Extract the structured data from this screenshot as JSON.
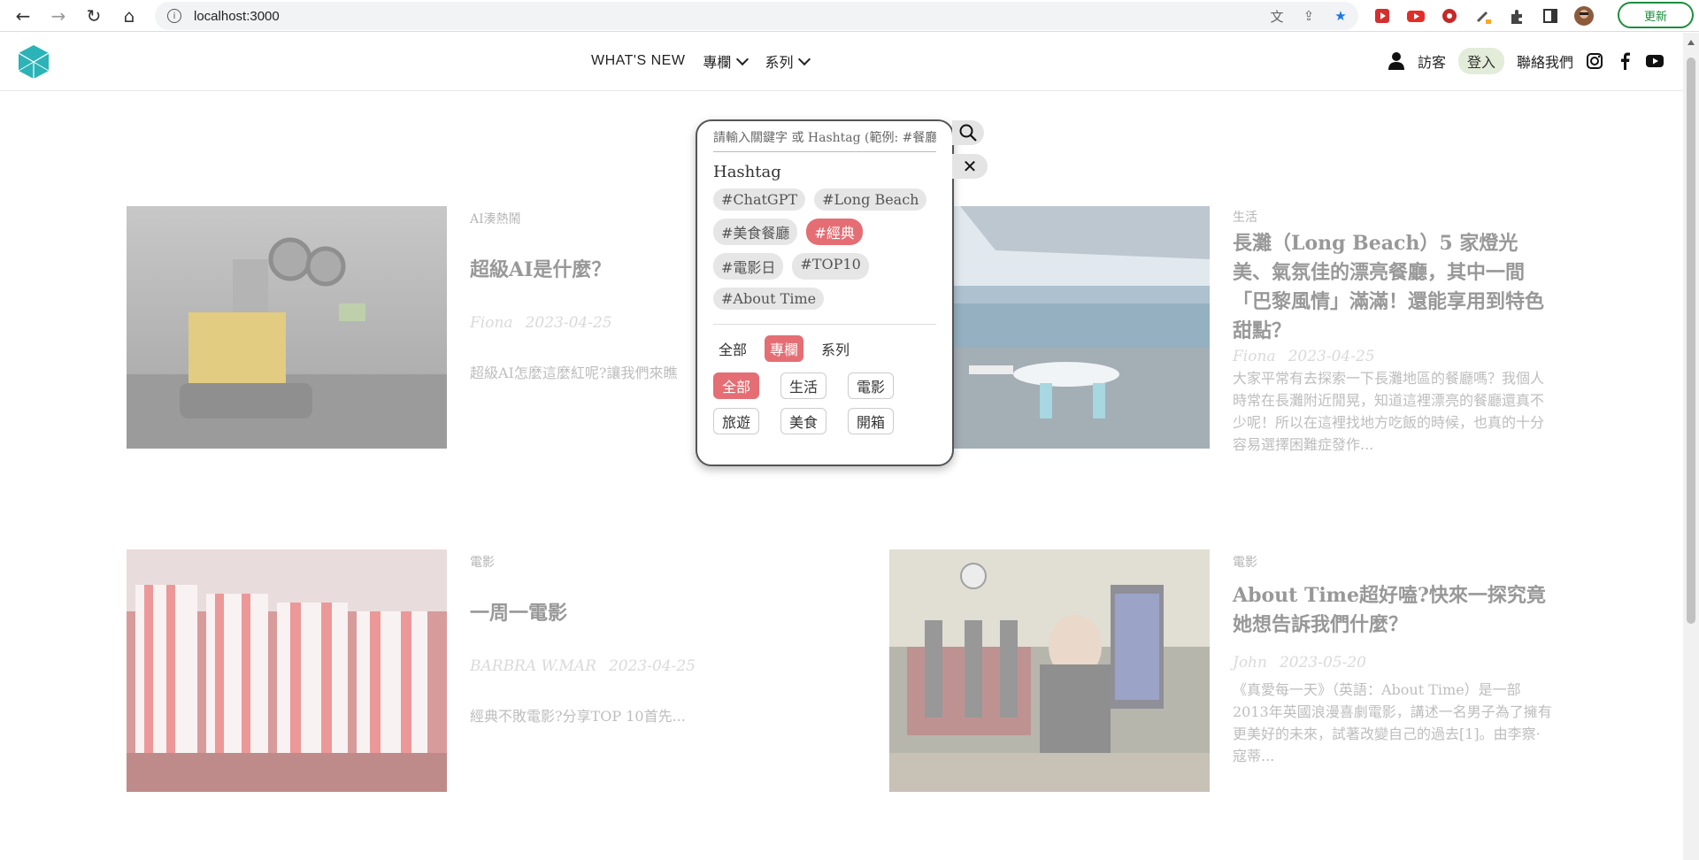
{
  "browser": {
    "url": "localhost:3000",
    "update_label": "更新"
  },
  "header": {
    "nav": {
      "whats_new": "WHAT'S NEW",
      "column": "專欄",
      "series": "系列"
    },
    "right": {
      "guest": "訪客",
      "login": "登入",
      "contact": "聯絡我們"
    }
  },
  "articles": [
    {
      "category": "AI湊熱鬧",
      "title": "超級AI是什麼？",
      "author": "Fiona",
      "date": "2023-04-25",
      "excerpt": "超級AI怎麼這麼紅呢?讓我們來瞧"
    },
    {
      "category": "生活",
      "title": "長灘（Long Beach）5 家燈光美、氣氛佳的漂亮餐廳，其中一間「巴黎風情」滿滿！還能享用到特色甜點？",
      "author": "Fiona",
      "date": "2023-04-25",
      "excerpt": "大家平常有去探索一下長灘地區的餐廳嗎？我個人時常在長灘附近閒晃，知道這裡漂亮的餐廳還真不少呢！所以在這裡找地方吃飯的時候，也真的十分容易選擇困難症發作..."
    },
    {
      "category": "電影",
      "title": "一周一電影",
      "author": "BARBRA W.MAR",
      "date": "2023-04-25",
      "excerpt": "經典不敗電影?分享TOP 10首先..."
    },
    {
      "category": "電影",
      "title": "About Time超好嗑?快來一探究竟她想告訴我們什麼？",
      "author": "John",
      "date": "2023-05-20",
      "excerpt": "《真愛每一天》（英語：About Time）是一部2013年英國浪漫喜劇電影，講述一名男子為了擁有更美好的未來，試著改變自己的過去[1]。由李察·寇蒂..."
    }
  ],
  "search": {
    "placeholder": "請輸入關鍵字 或 Hashtag (範例: #餐廳)",
    "hashtag_heading": "Hashtag",
    "tags": [
      "#ChatGPT",
      "#Long Beach",
      "#美食餐廳",
      "#經典",
      "#電影日",
      "#TOP10",
      "#About Time"
    ],
    "active_tag": "#經典",
    "type_filters": [
      "全部",
      "專欄",
      "系列"
    ],
    "active_type": "專欄",
    "category_filters": [
      "全部",
      "生活",
      "電影",
      "旅遊",
      "美食",
      "開箱"
    ],
    "active_category": "全部",
    "close_label": "✕"
  },
  "colors": {
    "accent": "#e46e74",
    "logo": "#2bb3b7",
    "login_bg": "#e3ecd9"
  }
}
